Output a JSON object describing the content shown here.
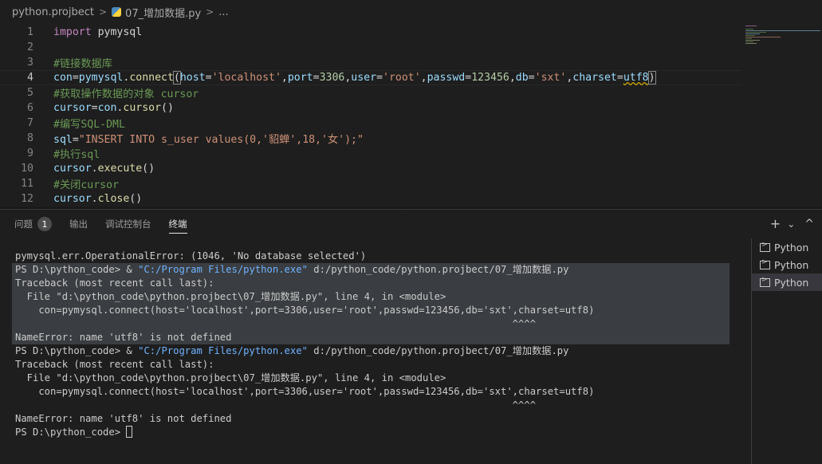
{
  "breadcrumb": {
    "folder": "python.projbect",
    "separator": ">",
    "file": "07_增加数据.py",
    "tail": "..."
  },
  "editor": {
    "line_numbers": [
      "1",
      "2",
      "3",
      "4",
      "5",
      "6",
      "7",
      "8",
      "9",
      "10",
      "11",
      "12"
    ],
    "current_line": "4",
    "lines": {
      "l1": {
        "kw": "import",
        "mod": "pymysql"
      },
      "l3": {
        "comment": "#链接数据库"
      },
      "l4": {
        "var": "con",
        "eq": "=",
        "obj": "pymysql",
        "dot": ".",
        "fn": "connect",
        "open": "(",
        "k1": "host",
        "v1": "'localhost'",
        "c1": ",",
        "k2": "port",
        "v2": "3306",
        "c2": ",",
        "k3": "user",
        "v3": "'root'",
        "c3": ",",
        "k4": "passwd",
        "v4": "123456",
        "c4": ",",
        "k5": "db",
        "v5": "'sxt'",
        "c5": ",",
        "k6": "charset",
        "v6": "utf8",
        "close": ")",
        "eqs": "="
      },
      "l5": {
        "comment": "#获取操作数据的对象 cursor"
      },
      "l6": {
        "var": "cursor",
        "eq": "=",
        "obj": "con",
        "dot": ".",
        "fn": "cursor",
        "parens": "()"
      },
      "l7": {
        "comment": "#编写SQL-DML"
      },
      "l8": {
        "var": "sql",
        "eq": "=",
        "str": "\"INSERT INTO s_user values(0,'貂蝉',18,'女');\""
      },
      "l9": {
        "comment": "#执行sql"
      },
      "l10": {
        "obj": "cursor",
        "dot": ".",
        "fn": "execute",
        "parens": "()"
      },
      "l11": {
        "comment": "#关闭cursor"
      },
      "l12": {
        "obj": "cursor",
        "dot": ".",
        "fn": "close",
        "parens": "()"
      }
    }
  },
  "panel": {
    "tabs": {
      "problems": "问题",
      "problems_count": "1",
      "output": "输出",
      "debug_console": "调试控制台",
      "terminal": "终端"
    },
    "actions": {
      "add": "+",
      "dropdown": "⌄",
      "collapse": "^"
    }
  },
  "terminal": {
    "lines": [
      {
        "text": "pymysql.err.OperationalError: (1046, 'No database selected')"
      },
      {
        "pre": "PS D:\\python_code> & ",
        "str": "\"C:/Program Files/python.exe\"",
        "post": " d:/python_code/python.projbect/07_增加数据.py"
      },
      {
        "text": "Traceback (most recent call last):"
      },
      {
        "text": "  File \"d:\\python_code\\python.projbect\\07_增加数据.py\", line 4, in <module>"
      },
      {
        "text": "    con=pymysql.connect(host='localhost',port=3306,user='root',passwd=123456,db='sxt',charset=utf8)"
      },
      {
        "text": "                                                                                     ^^^^"
      },
      {
        "text": "NameError: name 'utf8' is not defined"
      },
      {
        "pre": "PS D:\\python_code> & ",
        "str": "\"C:/Program Files/python.exe\"",
        "post": " d:/python_code/python.projbect/07_增加数据.py"
      },
      {
        "text": "Traceback (most recent call last):"
      },
      {
        "text": "  File \"d:\\python_code\\python.projbect\\07_增加数据.py\", line 4, in <module>"
      },
      {
        "text": "    con=pymysql.connect(host='localhost',port=3306,user='root',passwd=123456,db='sxt',charset=utf8)"
      },
      {
        "text": "                                                                                     ^^^^"
      },
      {
        "text": "NameError: name 'utf8' is not defined"
      },
      {
        "prompt": "PS D:\\python_code> "
      }
    ],
    "instances": [
      "Python",
      "Python",
      "Python"
    ]
  }
}
